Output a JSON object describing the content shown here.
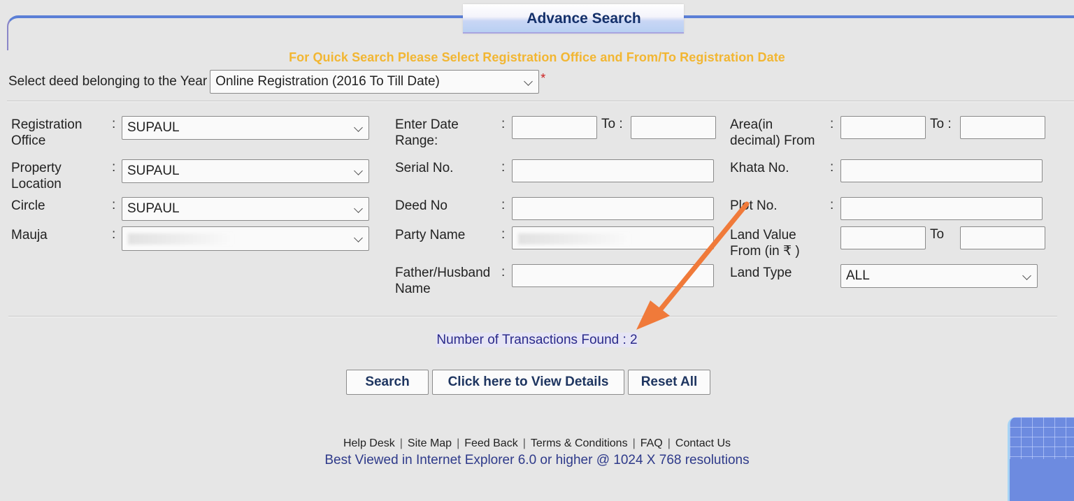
{
  "header": {
    "title": "Advance Search",
    "quick_note": "For Quick Search Please Select Registration Office and From/To Registration Date"
  },
  "year_select": {
    "label": "Select deed belonging to the Year",
    "value": "Online Registration (2016 To Till Date)",
    "required_mark": "*"
  },
  "colon": ":",
  "left_fields": {
    "registration_office": {
      "label": "Registration Office",
      "value": "SUPAUL"
    },
    "property_location": {
      "label": "Property Location",
      "value": "SUPAUL"
    },
    "circle": {
      "label": "Circle",
      "value": "SUPAUL"
    },
    "mauja": {
      "label": "Mauja",
      "value": ""
    }
  },
  "middle_fields": {
    "date_range": {
      "label": "Enter Date Range:",
      "from": "",
      "to_label": "To :",
      "to": ""
    },
    "serial_no": {
      "label": "Serial No.",
      "value": ""
    },
    "deed_no": {
      "label": "Deed No",
      "value": ""
    },
    "party_name": {
      "label": "Party Name",
      "value": ""
    },
    "father_husband_name": {
      "label": "Father/Husband Name",
      "value": ""
    }
  },
  "right_fields": {
    "area": {
      "label": "Area(in decimal) From",
      "from": "",
      "to_label": "To :",
      "to": ""
    },
    "khata_no": {
      "label": "Khata No.",
      "value": ""
    },
    "plot_no": {
      "label": "Plot No.",
      "value": ""
    },
    "land_value": {
      "label": "Land Value From (in ₹ )",
      "from": "",
      "to_label": "To",
      "to": ""
    },
    "land_type": {
      "label": "Land Type",
      "value": "ALL"
    }
  },
  "result": {
    "text": "Number of Transactions Found : 2",
    "count": 2
  },
  "buttons": {
    "search": "Search",
    "view_details": "Click here to View Details",
    "reset": "Reset All"
  },
  "footer": {
    "links": [
      "Help Desk",
      "Site Map",
      "Feed Back",
      "Terms & Conditions",
      "FAQ",
      "Contact Us"
    ],
    "separator": "|",
    "note": "Best Viewed in Internet Explorer 6.0 or higher @ 1024 X 768 resolutions"
  },
  "colors": {
    "frame_blue": "#5b7fd6",
    "title_text": "#14306a",
    "quick_note": "#f2b632",
    "result_text": "#2a2a8a",
    "annotation_arrow": "#f07a3a",
    "required": "#cc1f1f"
  }
}
